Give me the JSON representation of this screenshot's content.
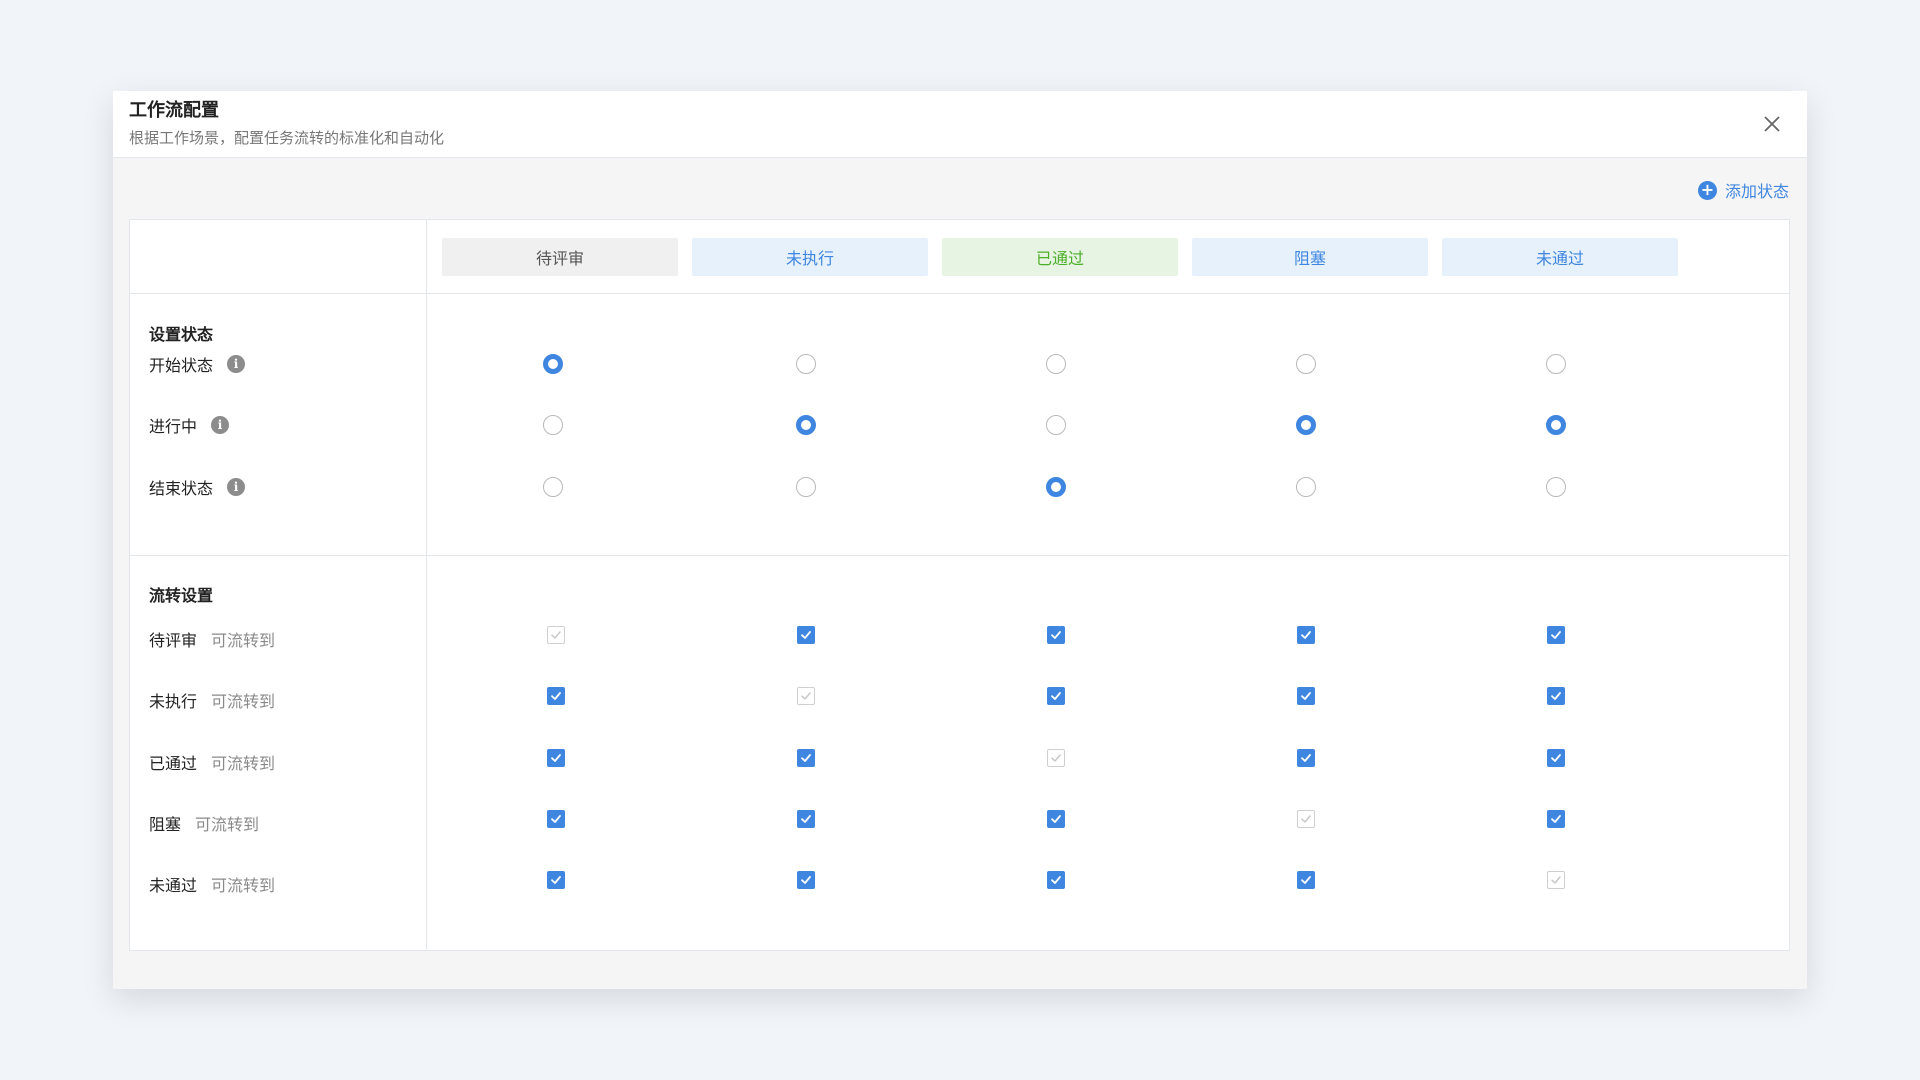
{
  "modal": {
    "title": "工作流配置",
    "subtitle": "根据工作场景，配置任务流转的标准化和自动化",
    "close_icon": "close-icon"
  },
  "add_status": {
    "label": "添加状态",
    "icon": "plus-circle-icon"
  },
  "statuses": [
    {
      "label": "待评审",
      "bg": "#f0f0f0",
      "color": "#555555"
    },
    {
      "label": "未执行",
      "bg": "#e6f1fc",
      "color": "#3f86e0"
    },
    {
      "label": "已通过",
      "bg": "#e7f4e4",
      "color": "#4caf28"
    },
    {
      "label": "阻塞",
      "bg": "#e6f1fc",
      "color": "#3f86e0"
    },
    {
      "label": "未通过",
      "bg": "#e6f1fc",
      "color": "#3f86e0"
    }
  ],
  "set_status": {
    "title": "设置状态",
    "rows": [
      {
        "label": "开始状态",
        "has_info": true,
        "selected_index": 0
      },
      {
        "label": "进行中",
        "has_info": true,
        "selected": [
          false,
          true,
          false,
          true,
          true
        ]
      },
      {
        "label": "结束状态",
        "has_info": true,
        "selected_index": 2
      }
    ]
  },
  "transition": {
    "title": "流转设置",
    "suffix": "可流转到",
    "rows": [
      {
        "label": "待评审",
        "checks": [
          "disabled",
          "checked",
          "checked",
          "checked",
          "checked"
        ]
      },
      {
        "label": "未执行",
        "checks": [
          "checked",
          "disabled",
          "checked",
          "checked",
          "checked"
        ]
      },
      {
        "label": "已通过",
        "checks": [
          "checked",
          "checked",
          "disabled",
          "checked",
          "checked"
        ]
      },
      {
        "label": "阻塞",
        "checks": [
          "checked",
          "checked",
          "checked",
          "disabled",
          "checked"
        ]
      },
      {
        "label": "未通过",
        "checks": [
          "checked",
          "checked",
          "checked",
          "checked",
          "disabled"
        ]
      }
    ]
  },
  "colors": {
    "accent": "#3f86e0"
  }
}
